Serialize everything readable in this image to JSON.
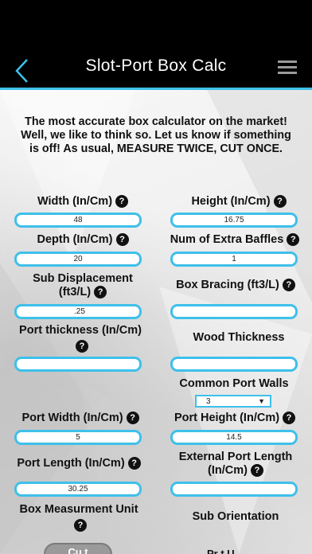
{
  "header": {
    "title": "Slot-Port Box Calc"
  },
  "intro": "The most accurate box calculator on the market! Well, we like to think so. Let us know if something is off! As usual, MEASURE TWICE, CUT ONCE.",
  "help_glyph": "?",
  "fields": {
    "width": {
      "label": "Width (In/Cm)",
      "value": "48"
    },
    "height": {
      "label": "Height (In/Cm)",
      "value": "16.75"
    },
    "depth": {
      "label": "Depth (In/Cm)",
      "value": "20"
    },
    "extra_baffles": {
      "label": "Num of Extra Baffles",
      "value": "1"
    },
    "sub_displacement": {
      "label_line1": "Sub Displacement",
      "label_line2": "(ft3/L)",
      "value": ".25"
    },
    "box_bracing": {
      "label": "Box Bracing (ft3/L)",
      "value": ""
    },
    "port_thickness": {
      "label": "Port thickness (In/Cm)",
      "value": ""
    },
    "wood_thickness": {
      "label": "Wood Thickness",
      "value": ""
    },
    "common_port_walls": {
      "label": "Common Port Walls",
      "value": "3"
    },
    "port_width": {
      "label": "Port Width (In/Cm)",
      "value": "5"
    },
    "port_height": {
      "label": "Port Height (In/Cm)",
      "value": "14.5"
    },
    "port_length": {
      "label": "Port Length (In/Cm)",
      "value": "30.25"
    },
    "external_port_length": {
      "label_line1": "External Port Length",
      "label_line2": "(In/Cm)",
      "value": ""
    },
    "box_measurement_unit": {
      "label": "Box Measurment Unit"
    },
    "sub_orientation": {
      "label": "Sub Orientation"
    }
  },
  "bottom": {
    "left_button": "Cu  t",
    "right_label": "Pr   t  U"
  },
  "colors": {
    "accent": "#3ec0ea",
    "header_bg": "#000000"
  }
}
